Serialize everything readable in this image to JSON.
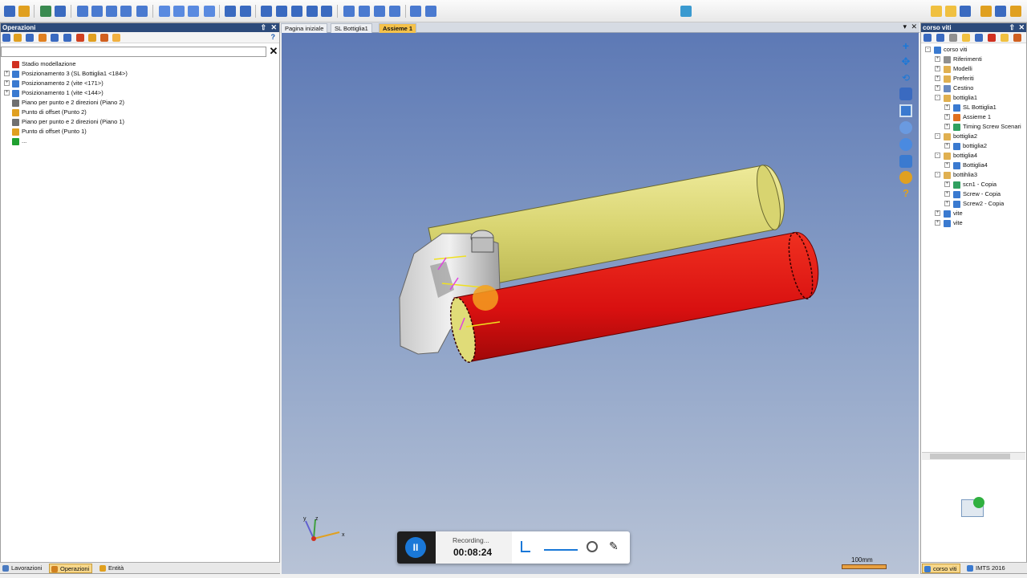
{
  "left_panel": {
    "title": "Operazioni",
    "pin": "⇧",
    "close": "✕",
    "help": "?",
    "search_value": "",
    "clear_label": "✕",
    "tree": [
      {
        "label": "Stadio modellazione",
        "icon_color": "#d03020",
        "expander": false
      },
      {
        "label": "Posizionamento 3 (SL Bottiglia1 <184>)",
        "icon_color": "#3a7ad0",
        "expander": true
      },
      {
        "label": "Posizionamento 2 (vite <171>)",
        "icon_color": "#3a7ad0",
        "expander": true
      },
      {
        "label": "Posizionamento 1 (vite <144>)",
        "icon_color": "#3a7ad0",
        "expander": true
      },
      {
        "label": "Piano per punto e 2 direzioni (Piano 2)",
        "icon_color": "#707070",
        "expander": false
      },
      {
        "label": "Punto di offset (Punto 2)",
        "icon_color": "#e0a020",
        "expander": false
      },
      {
        "label": "Piano per punto e 2 direzioni (Piano 1)",
        "icon_color": "#707070",
        "expander": false
      },
      {
        "label": "Punto di offset (Punto 1)",
        "icon_color": "#e0a020",
        "expander": false
      },
      {
        "label": "...",
        "icon_color": "#20a030",
        "expander": false
      }
    ],
    "tabs": [
      {
        "label": "Lavorazioni",
        "active": false,
        "icon_color": "#4a7ac0"
      },
      {
        "label": "Operazioni",
        "active": true,
        "icon_color": "#d08020"
      },
      {
        "label": "Entità",
        "active": false,
        "icon_color": "#e0a020"
      }
    ]
  },
  "doc_tabs": [
    {
      "label": "Pagina iniziale",
      "active": false
    },
    {
      "label": "SL Bottiglia1",
      "active": false
    },
    {
      "label": "Assieme 1",
      "active": true
    }
  ],
  "right_panel": {
    "title": "corso viti",
    "pin": "⇧",
    "close": "✕",
    "tree": [
      {
        "label": "corso viti",
        "depth": 0,
        "expander": "-",
        "icon_color": "#3a7ad0"
      },
      {
        "label": "Riferimenti",
        "depth": 1,
        "expander": "+",
        "icon_color": "#909090"
      },
      {
        "label": "Modelli",
        "depth": 1,
        "expander": "+",
        "icon_color": "#e0b050"
      },
      {
        "label": "Preferiti",
        "depth": 1,
        "expander": "+",
        "icon_color": "#e0b050"
      },
      {
        "label": "Cestino",
        "depth": 1,
        "expander": "+",
        "icon_color": "#6a8ac0"
      },
      {
        "label": "bottiglia1",
        "depth": 1,
        "expander": "-",
        "icon_color": "#e0b050"
      },
      {
        "label": "SL Bottiglia1",
        "depth": 2,
        "expander": "+",
        "icon_color": "#3a7ad0"
      },
      {
        "label": "Assieme 1",
        "depth": 2,
        "expander": "+",
        "icon_color": "#e07020"
      },
      {
        "label": "Timing Screw Scenari",
        "depth": 2,
        "expander": "+",
        "icon_color": "#30a060"
      },
      {
        "label": "bottiglia2",
        "depth": 1,
        "expander": "-",
        "icon_color": "#e0b050"
      },
      {
        "label": "bottiglia2",
        "depth": 2,
        "expander": "+",
        "icon_color": "#3a7ad0"
      },
      {
        "label": "bottiglia4",
        "depth": 1,
        "expander": "-",
        "icon_color": "#e0b050"
      },
      {
        "label": "Bottiglia4",
        "depth": 2,
        "expander": "+",
        "icon_color": "#3a7ad0"
      },
      {
        "label": "bottihlia3",
        "depth": 1,
        "expander": "-",
        "icon_color": "#e0b050"
      },
      {
        "label": "scn1 - Copia",
        "depth": 2,
        "expander": "+",
        "icon_color": "#30a060"
      },
      {
        "label": "Screw - Copia",
        "depth": 2,
        "expander": "+",
        "icon_color": "#3a7ad0"
      },
      {
        "label": "Screw2 - Copia",
        "depth": 2,
        "expander": "+",
        "icon_color": "#3a7ad0"
      },
      {
        "label": "vite",
        "depth": 1,
        "expander": "+",
        "icon_color": "#3a7ad0"
      },
      {
        "label": "vite",
        "depth": 1,
        "expander": "+",
        "icon_color": "#3a7ad0"
      }
    ],
    "tabs": [
      {
        "label": "corso viti",
        "active": true,
        "icon_color": "#3a7ad0"
      },
      {
        "label": "IMTS 2016",
        "active": false,
        "icon_color": "#3a7ad0"
      }
    ]
  },
  "viewport": {
    "axis_x": "x",
    "axis_y": "y",
    "axis_z": "z",
    "scale_label": "100mm",
    "tools": [
      "zoom-fit-icon",
      "pan-icon",
      "rotate-icon",
      "view-orient-icon",
      "view-layout-icon",
      "zoom-window-icon",
      "zoom-icon",
      "shading-icon",
      "render-icon",
      "help-icon"
    ]
  },
  "recorder": {
    "status": "Recording...",
    "time": "00:08:24",
    "pause_symbol": "II"
  },
  "colors": {
    "yellow_cylinder": "#d8d470",
    "red_cylinder": "#d81010",
    "title_bar": "#2c4a7a",
    "active_tab": "#f5c24a"
  }
}
